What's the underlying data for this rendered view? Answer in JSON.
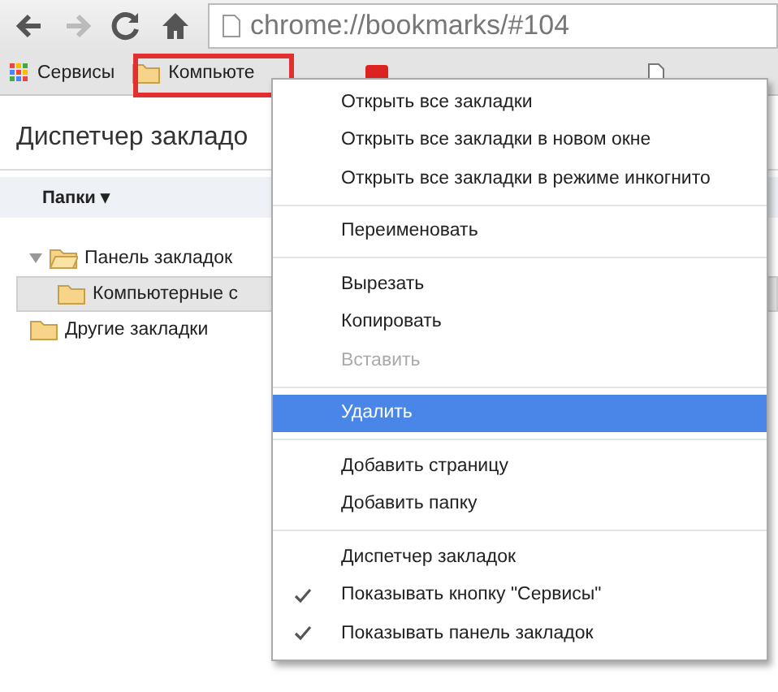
{
  "toolbar": {
    "address": "chrome://bookmarks/#104"
  },
  "bookmarks_bar": [
    {
      "kind": "apps",
      "label": "Сервисы"
    },
    {
      "kind": "folder",
      "label": "Компьюте"
    },
    {
      "kind": "video"
    },
    {
      "kind": "page"
    }
  ],
  "page": {
    "title": "Диспетчер закладо",
    "folders_header": "Папки ▾",
    "tree": [
      {
        "label": "Панель закладок",
        "expanded": true,
        "selected": false,
        "children": [
          {
            "label": "Компьютерные с",
            "selected": true
          }
        ]
      },
      {
        "label": "Другие закладки",
        "selected": false
      }
    ]
  },
  "menu": {
    "items": [
      {
        "kind": "item",
        "label": "Открыть все закладки",
        "disabled": false,
        "selected": false,
        "checked": false
      },
      {
        "kind": "item",
        "label": "Открыть все закладки в новом окне",
        "disabled": false,
        "selected": false,
        "checked": false
      },
      {
        "kind": "item",
        "label": "Открыть все закладки в режиме инкогнито",
        "disabled": false,
        "selected": false,
        "checked": false
      },
      {
        "kind": "separator"
      },
      {
        "kind": "item",
        "label": "Переименовать",
        "disabled": false,
        "selected": false,
        "checked": false
      },
      {
        "kind": "separator"
      },
      {
        "kind": "item",
        "label": "Вырезать",
        "disabled": false,
        "selected": false,
        "checked": false
      },
      {
        "kind": "item",
        "label": "Копировать",
        "disabled": false,
        "selected": false,
        "checked": false
      },
      {
        "kind": "item",
        "label": "Вставить",
        "disabled": true,
        "selected": false,
        "checked": false
      },
      {
        "kind": "separator"
      },
      {
        "kind": "item",
        "label": "Удалить",
        "disabled": false,
        "selected": true,
        "checked": false
      },
      {
        "kind": "separator"
      },
      {
        "kind": "item",
        "label": "Добавить страницу",
        "disabled": false,
        "selected": false,
        "checked": false
      },
      {
        "kind": "item",
        "label": "Добавить папку",
        "disabled": false,
        "selected": false,
        "checked": false
      },
      {
        "kind": "separator"
      },
      {
        "kind": "item",
        "label": "Диспетчер закладок",
        "disabled": false,
        "selected": false,
        "checked": false
      },
      {
        "kind": "item",
        "label": "Показывать кнопку \"Сервисы\"",
        "disabled": false,
        "selected": false,
        "checked": true
      },
      {
        "kind": "item",
        "label": "Показывать панель закладок",
        "disabled": false,
        "selected": false,
        "checked": true
      }
    ]
  }
}
